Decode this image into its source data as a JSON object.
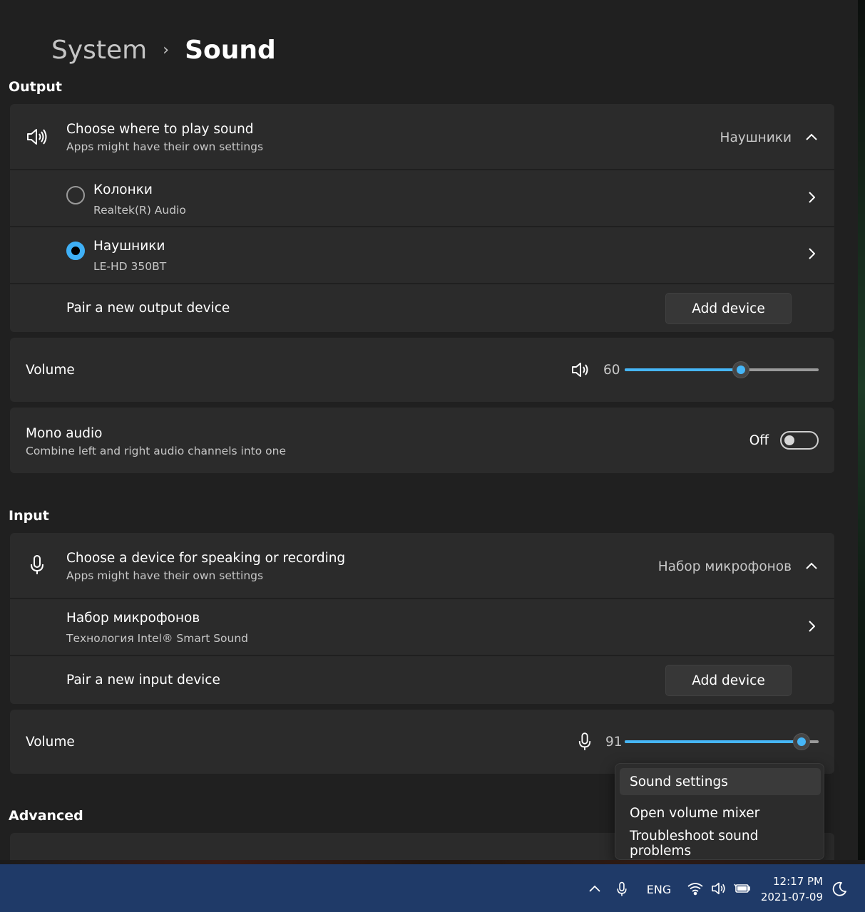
{
  "breadcrumb": {
    "parent": "System",
    "separator": "›",
    "current": "Sound"
  },
  "output": {
    "section_title": "Output",
    "choose": {
      "title": "Choose where to play sound",
      "subtitle": "Apps might have their own settings",
      "selected": "Наушники",
      "icon": "speaker-icon"
    },
    "devices": [
      {
        "name": "Колонки",
        "driver": "Realtek(R) Audio",
        "checked": false
      },
      {
        "name": "Наушники",
        "driver": "LE-HD 350BT",
        "checked": true
      }
    ],
    "pair": {
      "label": "Pair a new output device",
      "button": "Add device"
    },
    "volume": {
      "label": "Volume",
      "value": "60",
      "level": 60
    },
    "mono": {
      "title": "Mono audio",
      "subtitle": "Combine left and right audio channels into one",
      "state": "Off"
    }
  },
  "input": {
    "section_title": "Input",
    "choose": {
      "title": "Choose a device for speaking or recording",
      "subtitle": "Apps might have their own settings",
      "selected": "Набор микрофонов",
      "icon": "microphone-icon"
    },
    "devices": [
      {
        "name": "Набор микрофонов",
        "driver": "Технология Intel® Smart Sound"
      }
    ],
    "pair": {
      "label": "Pair a new input device",
      "button": "Add device"
    },
    "volume": {
      "label": "Volume",
      "value": "91",
      "level": 91
    }
  },
  "advanced": {
    "section_title": "Advanced"
  },
  "context_menu": {
    "items": [
      "Sound settings",
      "Open volume mixer",
      "Troubleshoot sound problems"
    ],
    "hovered_index": 0
  },
  "taskbar": {
    "language": "ENG",
    "time": "12:17 PM",
    "date": "2021-07-09",
    "icons": [
      "chevron-up-icon",
      "microphone-icon",
      "wifi-icon",
      "volume-icon",
      "battery-icon",
      "moon-icon"
    ]
  },
  "colors": {
    "accent": "#46b6f7",
    "background": "#202020",
    "card": "#2b2b2b",
    "taskbar": "#1f3a68"
  }
}
